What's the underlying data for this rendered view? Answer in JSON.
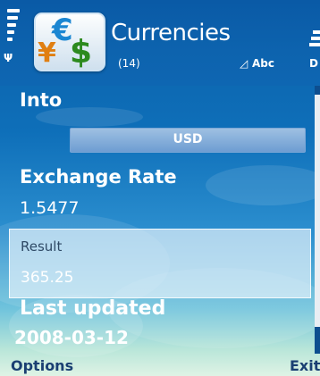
{
  "header": {
    "title": "Currencies",
    "count": "(14)",
    "input_mode": "Abc",
    "battery_letter": "D",
    "icon": "currency-app-icon",
    "icon_glyphs": {
      "euro": "€",
      "yen": "¥",
      "dollar": "$"
    }
  },
  "form": {
    "into_label": "Into",
    "into_value": "USD",
    "rate_label": "Exchange Rate",
    "rate_value": "1.5477",
    "result_label": "Result",
    "result_value": "365.25",
    "updated_label": "Last updated",
    "updated_value": "2008-03-12"
  },
  "softkeys": {
    "left": "Options",
    "right": "Exit"
  },
  "colors": {
    "background_top": "#0b5fa8",
    "background_bottom": "#dff3e5",
    "softkey_text": "#1a3f72"
  }
}
